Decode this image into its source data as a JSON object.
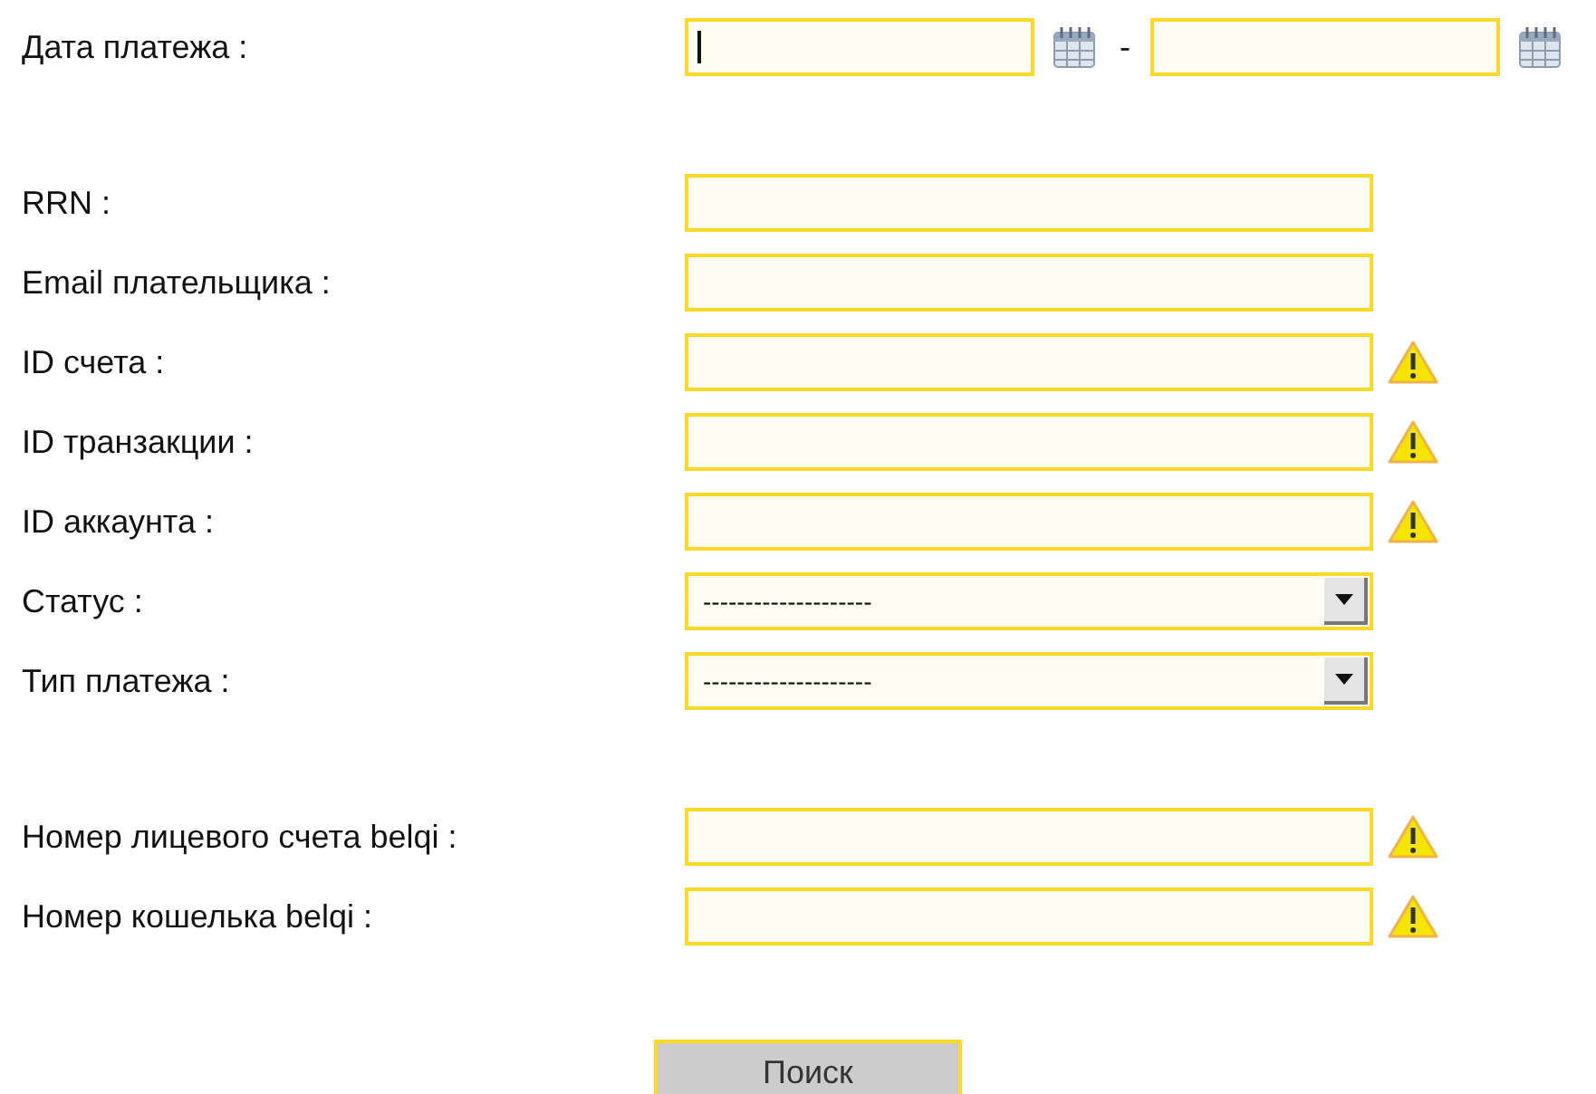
{
  "groups": [
    [
      {
        "kind": "date_range",
        "label": "Дата платежа :",
        "from": {
          "focused": true
        },
        "separator": "-",
        "to": {
          "focused": false
        }
      }
    ],
    [
      {
        "kind": "text",
        "label": "RRN :",
        "warning": false
      },
      {
        "kind": "text",
        "label": "Email плательщика :",
        "warning": false
      },
      {
        "kind": "text",
        "label": "ID счета :",
        "warning": true
      },
      {
        "kind": "text",
        "label": "ID транзакции :",
        "warning": true
      },
      {
        "kind": "text",
        "label": "ID аккаунта :",
        "warning": true
      },
      {
        "kind": "select",
        "label": "Статус :",
        "value": "--------------------"
      },
      {
        "kind": "select",
        "label": "Тип платежа :",
        "value": "--------------------"
      }
    ],
    [
      {
        "kind": "text",
        "label": "Номер лицевого счета belqi :",
        "warning": true
      },
      {
        "kind": "text",
        "label": "Номер кошелька belqi :",
        "warning": true
      }
    ]
  ],
  "search_button": "Поиск"
}
